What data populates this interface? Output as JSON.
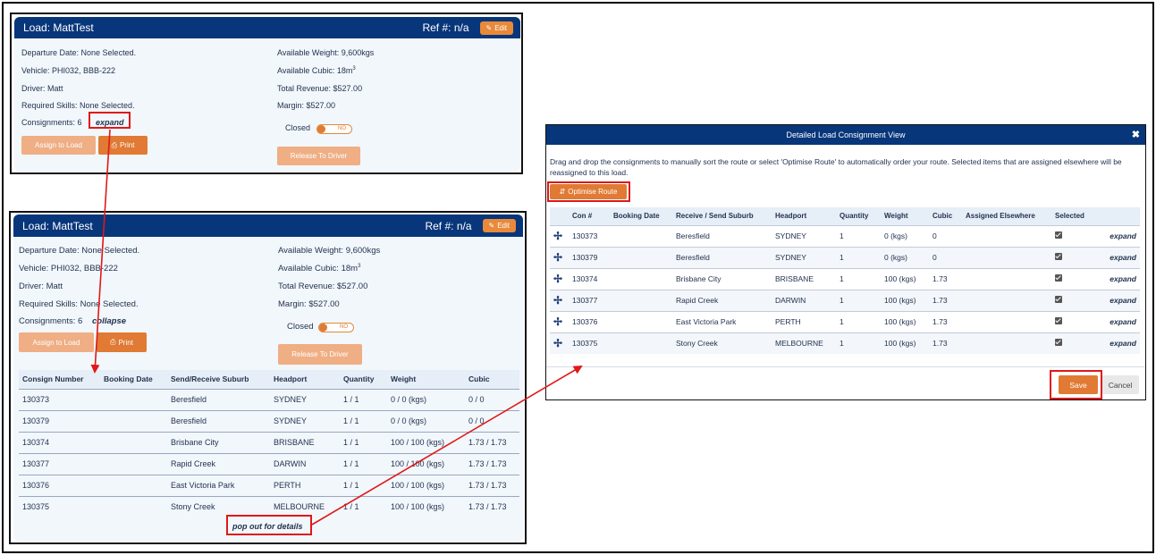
{
  "top_card": {
    "title": "Load: MattTest",
    "ref": "Ref #: n/a",
    "edit_label": "Edit",
    "left_fields": [
      "Departure Date: None Selected.",
      "Vehicle: PHI032, BBB-222",
      "Driver: Matt",
      "Required Skills: None Selected.",
      "Consignments: 6"
    ],
    "expand_label": "expand",
    "right_fields": {
      "weight": "Available Weight: 9,600kgs",
      "cubic": "Available Cubic: 18m",
      "cubic_sup": "3",
      "revenue": "Total Revenue: $527.00",
      "margin": "Margin: $527.00"
    },
    "closed_label": "Closed",
    "toggle_label": "NO",
    "assign_label": "Assign to Load",
    "print_label": "Print",
    "release_label": "Release To Driver"
  },
  "bottom_card": {
    "title": "Load: MattTest",
    "ref": "Ref #: n/a",
    "edit_label": "Edit",
    "left_fields": [
      "Departure Date: None Selected.",
      "Vehicle: PHI032, BBB-222",
      "Driver: Matt",
      "Required Skills: None Selected.",
      "Consignments: 6"
    ],
    "collapse_label": "collapse",
    "right_fields": {
      "weight": "Available Weight: 9,600kgs",
      "cubic": "Available Cubic: 18m",
      "cubic_sup": "3",
      "revenue": "Total Revenue: $527.00",
      "margin": "Margin: $527.00"
    },
    "closed_label": "Closed",
    "toggle_label": "NO",
    "assign_label": "Assign to Load",
    "print_label": "Print",
    "release_label": "Release To Driver",
    "table": {
      "headers": [
        "Consign Number",
        "Booking Date",
        "Send/Receive Suburb",
        "Headport",
        "Quantity",
        "Weight",
        "Cubic"
      ],
      "rows": [
        [
          "130373",
          "",
          "Beresfield",
          "SYDNEY",
          "1 / 1",
          "0 / 0 (kgs)",
          "0 / 0"
        ],
        [
          "130379",
          "",
          "Beresfield",
          "SYDNEY",
          "1 / 1",
          "0 / 0 (kgs)",
          "0 / 0"
        ],
        [
          "130374",
          "",
          "Brisbane City",
          "BRISBANE",
          "1 / 1",
          "100 / 100 (kgs)",
          "1.73 / 1.73"
        ],
        [
          "130377",
          "",
          "Rapid Creek",
          "DARWIN",
          "1 / 1",
          "100 / 100 (kgs)",
          "1.73 / 1.73"
        ],
        [
          "130376",
          "",
          "East Victoria Park",
          "PERTH",
          "1 / 1",
          "100 / 100 (kgs)",
          "1.73 / 1.73"
        ],
        [
          "130375",
          "",
          "Stony Creek",
          "MELBOURNE",
          "1 / 1",
          "100 / 100 (kgs)",
          "1.73 / 1.73"
        ]
      ]
    },
    "popout_label": "pop out for details"
  },
  "dialog": {
    "title": "Detailed Load Consignment View",
    "close_glyph": "✖",
    "description": "Drag and drop the consignments to manually sort the route or select 'Optimise Route' to automatically order your route. Selected items that are assigned elsewhere will be reassigned to this load.",
    "optimise_label": "Optimise Route",
    "headers": [
      "",
      "Con #",
      "Booking Date",
      "Receive / Send Suburb",
      "Headport",
      "Quantity",
      "Weight",
      "Cubic",
      "Assigned Elsewhere",
      "Selected",
      ""
    ],
    "rows": [
      [
        "130373",
        "",
        "Beresfield",
        "SYDNEY",
        "1",
        "0 (kgs)",
        "0",
        "",
        "expand"
      ],
      [
        "130379",
        "",
        "Beresfield",
        "SYDNEY",
        "1",
        "0 (kgs)",
        "0",
        "",
        "expand"
      ],
      [
        "130374",
        "",
        "Brisbane City",
        "BRISBANE",
        "1",
        "100 (kgs)",
        "1.73",
        "",
        "expand"
      ],
      [
        "130377",
        "",
        "Rapid Creek",
        "DARWIN",
        "1",
        "100 (kgs)",
        "1.73",
        "",
        "expand"
      ],
      [
        "130376",
        "",
        "East Victoria Park",
        "PERTH",
        "1",
        "100 (kgs)",
        "1.73",
        "",
        "expand"
      ],
      [
        "130375",
        "",
        "Stony Creek",
        "MELBOURNE",
        "1",
        "100 (kgs)",
        "1.73",
        "",
        "expand"
      ]
    ],
    "save_label": "Save",
    "cancel_label": "Cancel"
  },
  "colors": {
    "header_navy": "#08367a",
    "accent_orange": "#e07a34",
    "light_orange": "#efae84",
    "highlight_red": "#e01818"
  }
}
